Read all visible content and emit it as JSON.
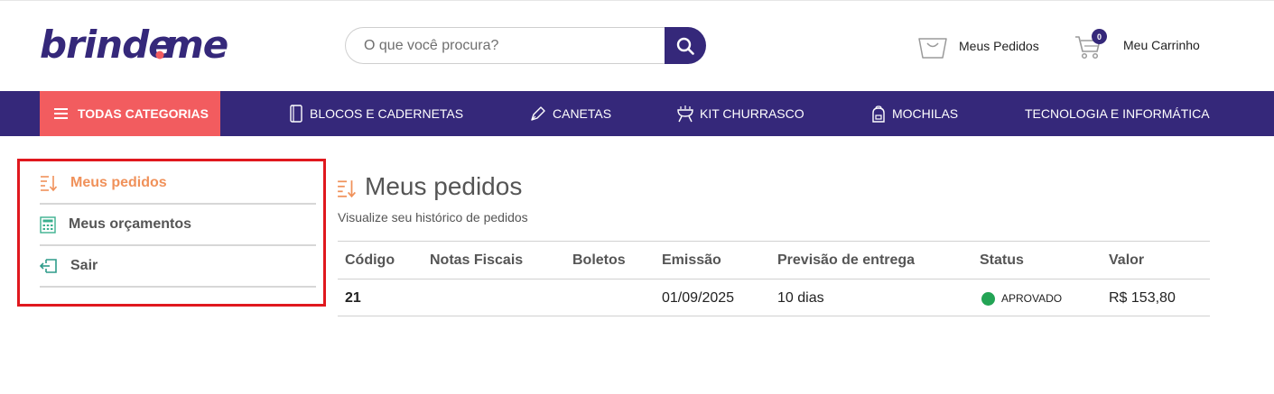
{
  "header": {
    "logo_text": "brinde.me",
    "search": {
      "placeholder": "O que você procura?",
      "value": ""
    },
    "orders_label": "Meus Pedidos",
    "cart_label": "Meu Carrinho",
    "cart_count": "0"
  },
  "nav": {
    "all_categories": "TODAS CATEGORIAS",
    "items": [
      {
        "label": "BLOCOS E CADERNETAS",
        "icon": "notebook-icon"
      },
      {
        "label": "CANETAS",
        "icon": "pen-icon"
      },
      {
        "label": "KIT CHURRASCO",
        "icon": "grill-icon"
      },
      {
        "label": "MOCHILAS",
        "icon": "backpack-icon"
      },
      {
        "label": "TECNOLOGIA E INFORMÁTICA",
        "icon": ""
      }
    ]
  },
  "sidebar": {
    "items": [
      {
        "label": "Meus pedidos",
        "icon": "sort-list-icon",
        "active": true
      },
      {
        "label": "Meus orçamentos",
        "icon": "calculator-icon",
        "active": false
      },
      {
        "label": "Sair",
        "icon": "logout-icon",
        "active": false
      }
    ]
  },
  "main": {
    "title": "Meus pedidos",
    "subtitle": "Visualize seu histórico de pedidos",
    "table": {
      "headers": [
        "Código",
        "Notas Fiscais",
        "Boletos",
        "Emissão",
        "Previsão de entrega",
        "Status",
        "Valor"
      ],
      "rows": [
        {
          "codigo": "21",
          "notas": "",
          "boletos": "",
          "emissao": "01/09/2025",
          "previsao": "10 dias",
          "status": "APROVADO",
          "valor": "R$ 153,80"
        }
      ]
    }
  },
  "colors": {
    "brand": "#35287a",
    "accent_red": "#f25c5f",
    "active_orange": "#f0915a",
    "status_green": "#23a455",
    "highlight_border": "#e0181e"
  }
}
